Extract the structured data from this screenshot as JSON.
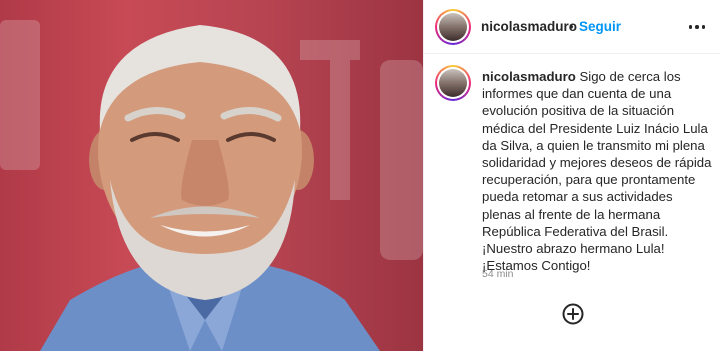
{
  "post": {
    "username": "nicolasmaduro",
    "separator": "•",
    "follow_label": "Seguir",
    "caption_text": "Sigo de cerca los informes que dan cuenta de una evolución positiva de la situación médica del Presidente Luiz Inácio Lula da Silva, a quien le transmito mi plena solidaridad y mejores deseos de rápida recuperación, para que prontamente pueda retomar a sus actividades plenas al frente de la hermana República Federativa del Brasil. ¡Nuestro abrazo hermano Lula! ¡Estamos Contigo!",
    "timestamp": "54 min"
  },
  "icons": {
    "more": "more-options-icon",
    "add": "add-circle-icon"
  },
  "colors": {
    "accent": "#0095f6",
    "text": "#262626",
    "muted": "#8e8e8e",
    "photo_background": "#b03a48"
  }
}
